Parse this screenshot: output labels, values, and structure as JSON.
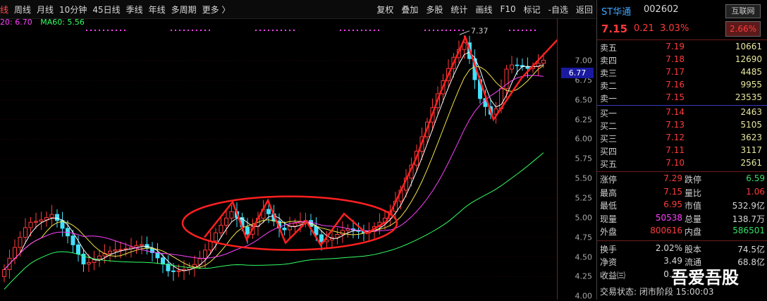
{
  "toolbar": {
    "left": [
      "线",
      "周线",
      "月线",
      "10分钟",
      "45日线",
      "季线",
      "年线",
      "多周期",
      "更多 〉"
    ],
    "right": [
      "复权",
      "叠加",
      "多股",
      "统计",
      "画线",
      "F10",
      "标记",
      "-自选",
      "返回"
    ]
  },
  "ma_legend": {
    "ma20": "20: 6.70",
    "ma60": "MA60: 5.56"
  },
  "current_price_tag": "6.77",
  "high_marker": "7.37",
  "price_axis": [
    "7.00",
    "6.75",
    "6.50",
    "6.25",
    "6.00",
    "5.75",
    "5.50",
    "5.25",
    "5.00",
    "4.75",
    "4.50",
    "4.25",
    "4.00"
  ],
  "header": {
    "name": "ST华通",
    "code": "002602",
    "price": "7.15",
    "change": "0.21",
    "pct": "3.03%",
    "tag": "互联网",
    "tag_pct": "2.66%"
  },
  "asks": [
    {
      "label": "卖五",
      "price": "7.19",
      "vol": "10661"
    },
    {
      "label": "卖四",
      "price": "7.18",
      "vol": "12690"
    },
    {
      "label": "卖三",
      "price": "7.17",
      "vol": "4485"
    },
    {
      "label": "卖二",
      "price": "7.16",
      "vol": "9955"
    },
    {
      "label": "卖一",
      "price": "7.15",
      "vol": "23535"
    }
  ],
  "bids": [
    {
      "label": "买一",
      "price": "7.14",
      "vol": "2463"
    },
    {
      "label": "买二",
      "price": "7.13",
      "vol": "5105"
    },
    {
      "label": "买三",
      "price": "7.12",
      "vol": "3623"
    },
    {
      "label": "买四",
      "price": "7.11",
      "vol": "3117"
    },
    {
      "label": "买五",
      "price": "7.10",
      "vol": "2561"
    }
  ],
  "stats1": [
    {
      "l1": "涨停",
      "v1": "7.29",
      "c1": "c-red",
      "l2": "跌停",
      "v2": "6.59",
      "c2": "c-green"
    },
    {
      "l1": "最高",
      "v1": "7.15",
      "c1": "c-red",
      "l2": "量比",
      "v2": "1.06",
      "c2": "c-red"
    },
    {
      "l1": "最低",
      "v1": "6.95",
      "c1": "c-red",
      "l2": "市值",
      "v2": "532.9亿",
      "c2": "c-white"
    },
    {
      "l1": "现量",
      "v1": "50538",
      "c1": "c-mag",
      "l2": "总量",
      "v2": "138.7万",
      "c2": "c-white"
    },
    {
      "l1": "外盘",
      "v1": "800616",
      "c1": "c-red",
      "l2": "内盘",
      "v2": "586501",
      "c2": "c-green"
    }
  ],
  "stats2": [
    {
      "l1": "换手",
      "v1": "2.02%",
      "c1": "c-white",
      "l2": "股本",
      "v2": "74.5亿",
      "c2": "c-white"
    },
    {
      "l1": "净资",
      "v1": "3.49",
      "c1": "c-white",
      "l2": "流通",
      "v2": "68.8亿",
      "c2": "c-white"
    },
    {
      "l1": "收益㈢",
      "v1": "0.25",
      "c1": "c-white",
      "l2": "",
      "v2": "",
      "c2": "c-white"
    }
  ],
  "status_text": "交易状态: 闭市阶段 15:00:03",
  "watermark": "吾爱吾股"
}
